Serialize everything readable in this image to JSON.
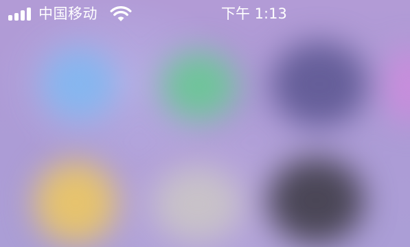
{
  "status_bar": {
    "carrier": "中国移动",
    "time": "下午 1:13",
    "icons": {
      "signal": "cellular-signal-icon",
      "wifi": "wifi-icon"
    }
  },
  "home_screen": {
    "blurred": true,
    "app_icons": [
      {
        "name": "blurred-app-icon-1",
        "color": "#86b6ef"
      },
      {
        "name": "blurred-app-icon-2",
        "color": "#6fc49a"
      },
      {
        "name": "blurred-app-icon-3",
        "color": "#655e99"
      },
      {
        "name": "blurred-app-icon-4",
        "color": "#e6c36d"
      },
      {
        "name": "blurred-app-icon-5",
        "color": "#c8c2c8"
      },
      {
        "name": "blurred-app-icon-6",
        "color": "#4a4656"
      }
    ]
  },
  "colors": {
    "background": "#ab98d2",
    "status_text": "#ffffff"
  }
}
